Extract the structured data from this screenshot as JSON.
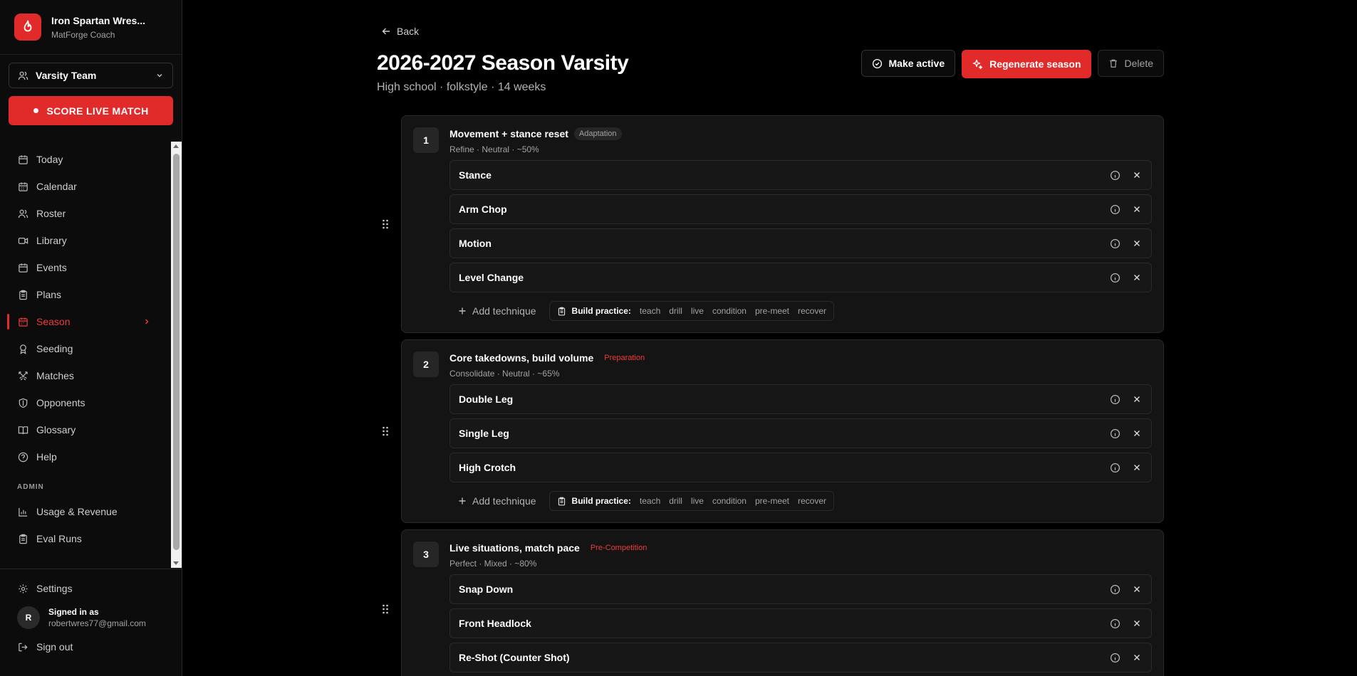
{
  "brand": {
    "name": "Iron Spartan Wres...",
    "subtitle": "MatForge Coach"
  },
  "team_select": {
    "value": "Varsity Team"
  },
  "live_button": {
    "label": "SCORE LIVE MATCH"
  },
  "nav": {
    "items": [
      {
        "label": "Today",
        "icon": "calendar-icon"
      },
      {
        "label": "Calendar",
        "icon": "calendar-grid-icon"
      },
      {
        "label": "Roster",
        "icon": "users-icon"
      },
      {
        "label": "Library",
        "icon": "video-icon"
      },
      {
        "label": "Events",
        "icon": "calendar-icon"
      },
      {
        "label": "Plans",
        "icon": "clipboard-icon"
      },
      {
        "label": "Season",
        "icon": "calendar-icon",
        "active": true
      },
      {
        "label": "Seeding",
        "icon": "award-icon"
      },
      {
        "label": "Matches",
        "icon": "swords-icon"
      },
      {
        "label": "Opponents",
        "icon": "shield-icon"
      },
      {
        "label": "Glossary",
        "icon": "book-icon"
      },
      {
        "label": "Help",
        "icon": "help-icon"
      }
    ],
    "admin_label": "ADMIN",
    "admin_items": [
      {
        "label": "Usage & Revenue",
        "icon": "bar-chart-icon"
      },
      {
        "label": "Eval Runs",
        "icon": "clipboard-icon"
      }
    ]
  },
  "footer": {
    "settings_label": "Settings",
    "user": {
      "initial": "R",
      "title": "Signed in as",
      "email": "robertwres77@gmail.com"
    },
    "signout_label": "Sign out"
  },
  "page": {
    "back_label": "Back",
    "title": "2026-2027 Season Varsity",
    "subtitle": "High school · folkstyle · 14 weeks",
    "actions": {
      "make_active": "Make active",
      "regenerate": "Regenerate season",
      "delete": "Delete"
    }
  },
  "build": {
    "label": "Build practice:",
    "options": [
      "teach",
      "drill",
      "live",
      "condition",
      "pre-meet",
      "recover"
    ]
  },
  "add_technique_label": "Add technique",
  "weeks": [
    {
      "num": "1",
      "title": "Movement + stance reset",
      "phase": "Adaptation",
      "phase_style": "gray",
      "meta": "Refine · Neutral · ~50%",
      "techniques": [
        "Stance",
        "Arm Chop",
        "Motion",
        "Level Change"
      ]
    },
    {
      "num": "2",
      "title": "Core takedowns, build volume",
      "phase": "Preparation",
      "phase_style": "red",
      "meta": "Consolidate · Neutral · ~65%",
      "techniques": [
        "Double Leg",
        "Single Leg",
        "High Crotch"
      ]
    },
    {
      "num": "3",
      "title": "Live situations, match pace",
      "phase": "Pre-Competition",
      "phase_style": "red",
      "meta": "Perfect · Mixed · ~80%",
      "techniques": [
        "Snap Down",
        "Front Headlock",
        "Re-Shot (Counter Shot)"
      ]
    }
  ],
  "colors": {
    "accent": "#e12b2b",
    "bg": "#000000",
    "card": "#141414"
  }
}
